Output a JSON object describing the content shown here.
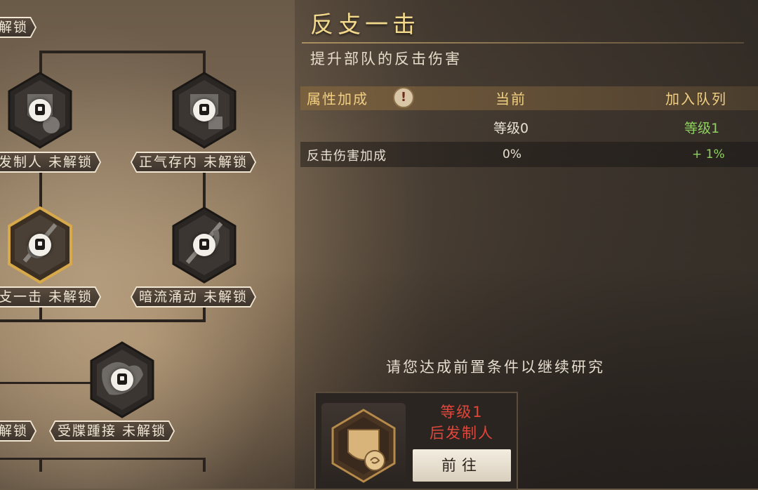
{
  "skill_tree": {
    "top_partial_label": "解锁",
    "row2_left_label": "发制人 未解锁",
    "row2_right_label": "正气存内 未解锁",
    "row3_left_label": "攴一击 未解锁",
    "row3_right_label": "暗流涌动 未解锁",
    "row4_left_partial_label": "解锁",
    "row4_center_label": "受牒踵接 未解锁"
  },
  "detail": {
    "title": "反攴一击",
    "description": "提升部队的反击伤害",
    "table_header": {
      "attribute_label": "属性加成",
      "info_icon_glyph": "!",
      "current_label": "当前",
      "join_label": "加入队列"
    },
    "level_row": {
      "current": "等级0",
      "join": "等级1"
    },
    "attributes": [
      {
        "name": "反击伤害加成",
        "current": "0%",
        "join": "+ 1%"
      }
    ],
    "prompt": "请您达成前置条件以继续研究",
    "requirement": {
      "level_text": "等级1",
      "skill_name": "后发制人",
      "goto_label": "前往"
    }
  },
  "colors": {
    "title_gold": "#f3d98c",
    "header_gold": "#f0cf82",
    "green_value": "#8fd160",
    "requirement_red": "#e0463a",
    "selected_node_border": "#d8a94a"
  }
}
